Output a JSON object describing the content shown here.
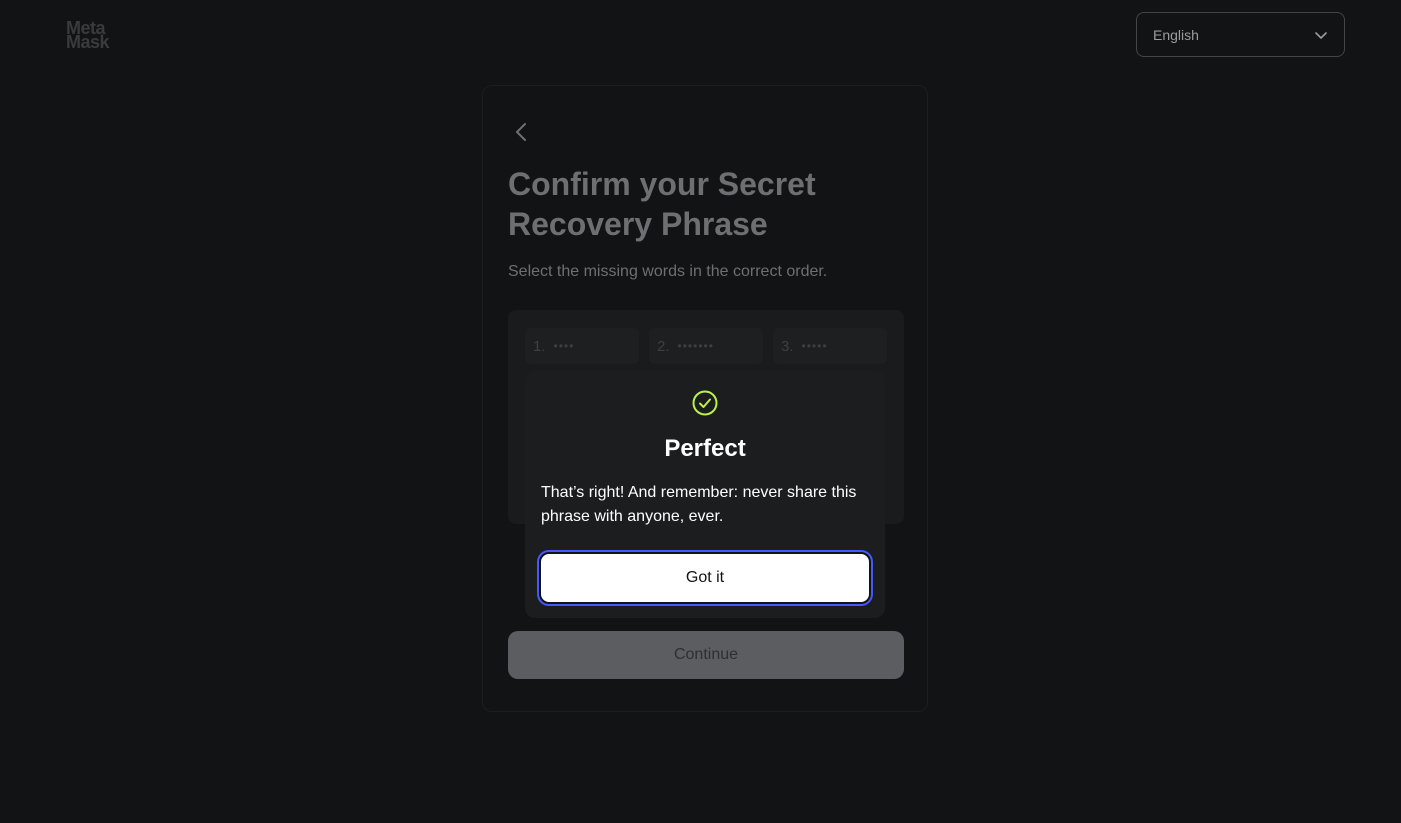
{
  "header": {
    "logo_line1": "Meta",
    "logo_line2": "Mask",
    "language": "English"
  },
  "card": {
    "title": "Confirm your Secret Recovery Phrase",
    "subtitle": "Select the missing words in the correct order.",
    "words": [
      {
        "num": "1.",
        "mask": "••••"
      },
      {
        "num": "2.",
        "mask": "•••••••"
      },
      {
        "num": "3.",
        "mask": "•••••"
      }
    ],
    "continue_label": "Continue"
  },
  "modal": {
    "title": "Perfect",
    "body": "That’s right! And remember: never share this phrase with anyone, ever.",
    "button_label": "Got it",
    "icon": "check-circle-icon",
    "icon_color": "#baf24a"
  },
  "colors": {
    "background": "#121314",
    "accent_focus": "#4459ff"
  }
}
